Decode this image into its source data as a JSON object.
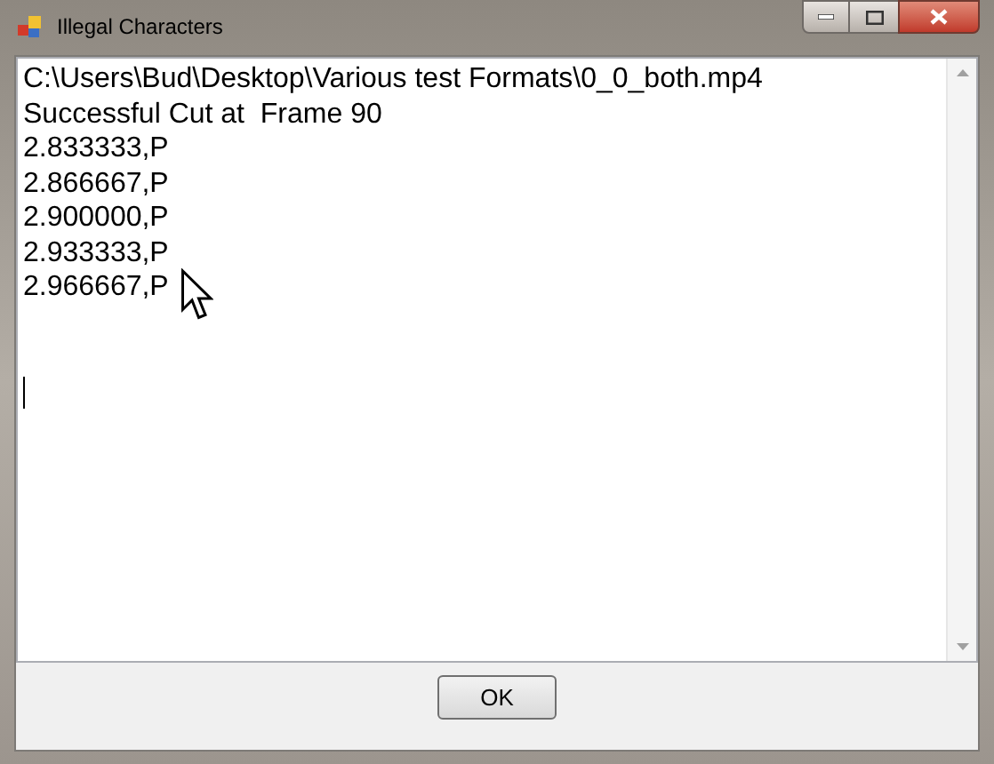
{
  "window": {
    "title": "Illegal Characters"
  },
  "text_box": {
    "lines": [
      "C:\\Users\\Bud\\Desktop\\Various test Formats\\0_0_both.mp4",
      "Successful Cut at  Frame 90",
      "2.833333,P",
      "2.866667,P",
      "2.900000,P",
      "2.933333,P",
      "2.966667,P"
    ]
  },
  "buttons": [
    "OK"
  ]
}
